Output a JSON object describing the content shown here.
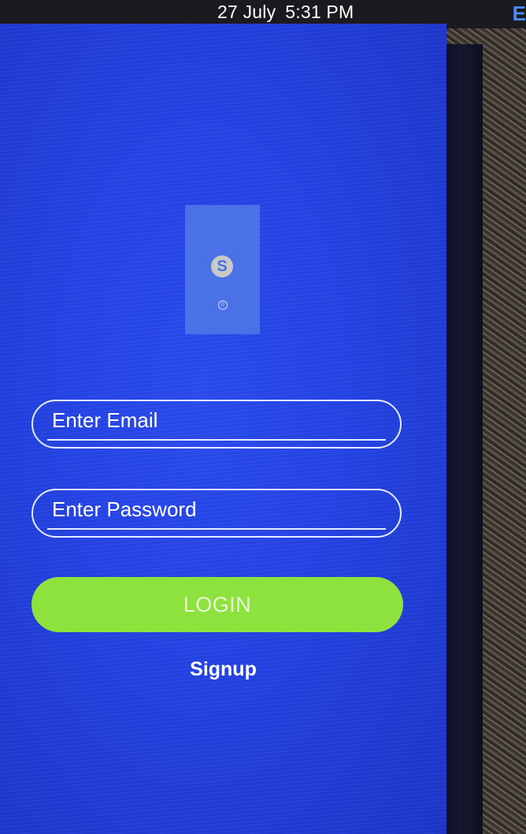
{
  "status_bar": {
    "date": "27 July",
    "time": "5:31 PM",
    "edge_glyph": "E"
  },
  "logo": {
    "glyph": "S",
    "small_glyph": "0",
    "icon": "app-logo-icon",
    "color": "#4a72e6"
  },
  "form": {
    "email_placeholder": "Enter Email",
    "password_placeholder": "Enter Password",
    "login_label": "LOGIN",
    "signup_label": "Signup"
  },
  "colors": {
    "background": "#2443e4",
    "login_button": "#8ee23d",
    "input_border": "#e6ecff"
  }
}
